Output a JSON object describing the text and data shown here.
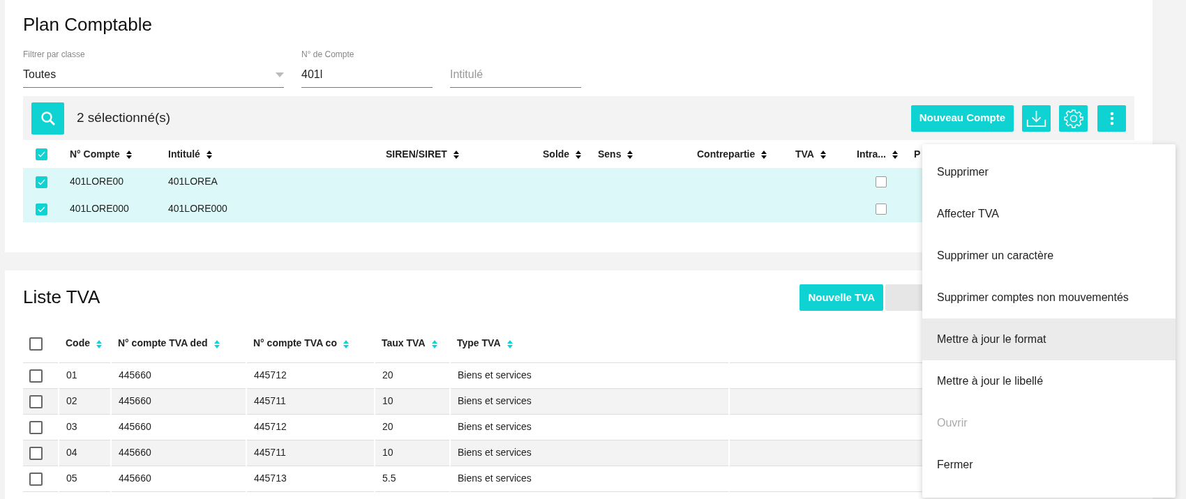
{
  "plan": {
    "title": "Plan Comptable",
    "filters": [
      {
        "kind": "select",
        "label": "Filtrer par classe",
        "value": "Toutes"
      },
      {
        "kind": "text",
        "label": "N° de Compte",
        "value": "401l"
      },
      {
        "kind": "text",
        "placeholder": "Intitulé"
      }
    ],
    "toolbar": {
      "selection": "2 sélectionné(s)",
      "new_button": "Nouveau Compte"
    },
    "table": {
      "all_checked": true,
      "columns": [
        "N° Compte",
        "Intitulé",
        "SIREN/SIRET",
        "Solde",
        "Sens",
        "Contrepartie",
        "TVA",
        "Intra...",
        "P"
      ],
      "rows": [
        {
          "selected": true,
          "cells": [
            "401LORE00",
            "401LOREA"
          ],
          "intra_checked": false
        },
        {
          "selected": true,
          "cells": [
            "401LORE000",
            "401LORE000"
          ],
          "intra_checked": false
        }
      ]
    }
  },
  "tva": {
    "title": "Liste TVA",
    "new_button": "Nouvelle TVA",
    "all_checked": false,
    "columns": [
      "Code",
      "N° compte TVA ded",
      "N° compte TVA co",
      "Taux TVA",
      "Type TVA"
    ],
    "rows": [
      {
        "checked": false,
        "cells": [
          "01",
          "445660",
          "445712",
          "20",
          "Biens et services"
        ]
      },
      {
        "checked": false,
        "cells": [
          "02",
          "445660",
          "445711",
          "10",
          "Biens et services"
        ]
      },
      {
        "checked": false,
        "cells": [
          "03",
          "445660",
          "445712",
          "20",
          "Biens et services"
        ]
      },
      {
        "checked": false,
        "cells": [
          "04",
          "445660",
          "445711",
          "10",
          "Biens et services"
        ]
      },
      {
        "checked": false,
        "cells": [
          "05",
          "445660",
          "445713",
          "5.5",
          "Biens et services"
        ]
      }
    ]
  },
  "menu": {
    "items": [
      {
        "label": "Supprimer",
        "hovered": false,
        "disabled": false
      },
      {
        "label": "Affecter TVA",
        "hovered": false,
        "disabled": false
      },
      {
        "label": "Supprimer un caractère",
        "hovered": false,
        "disabled": false
      },
      {
        "label": "Supprimer comptes non mouvementés",
        "hovered": false,
        "disabled": false
      },
      {
        "label": "Mettre à jour le format",
        "hovered": true,
        "disabled": false
      },
      {
        "label": "Mettre à jour le libellé",
        "hovered": false,
        "disabled": false
      },
      {
        "label": "Ouvrir",
        "hovered": false,
        "disabled": true
      },
      {
        "label": "Fermer",
        "hovered": false,
        "disabled": false
      }
    ]
  }
}
